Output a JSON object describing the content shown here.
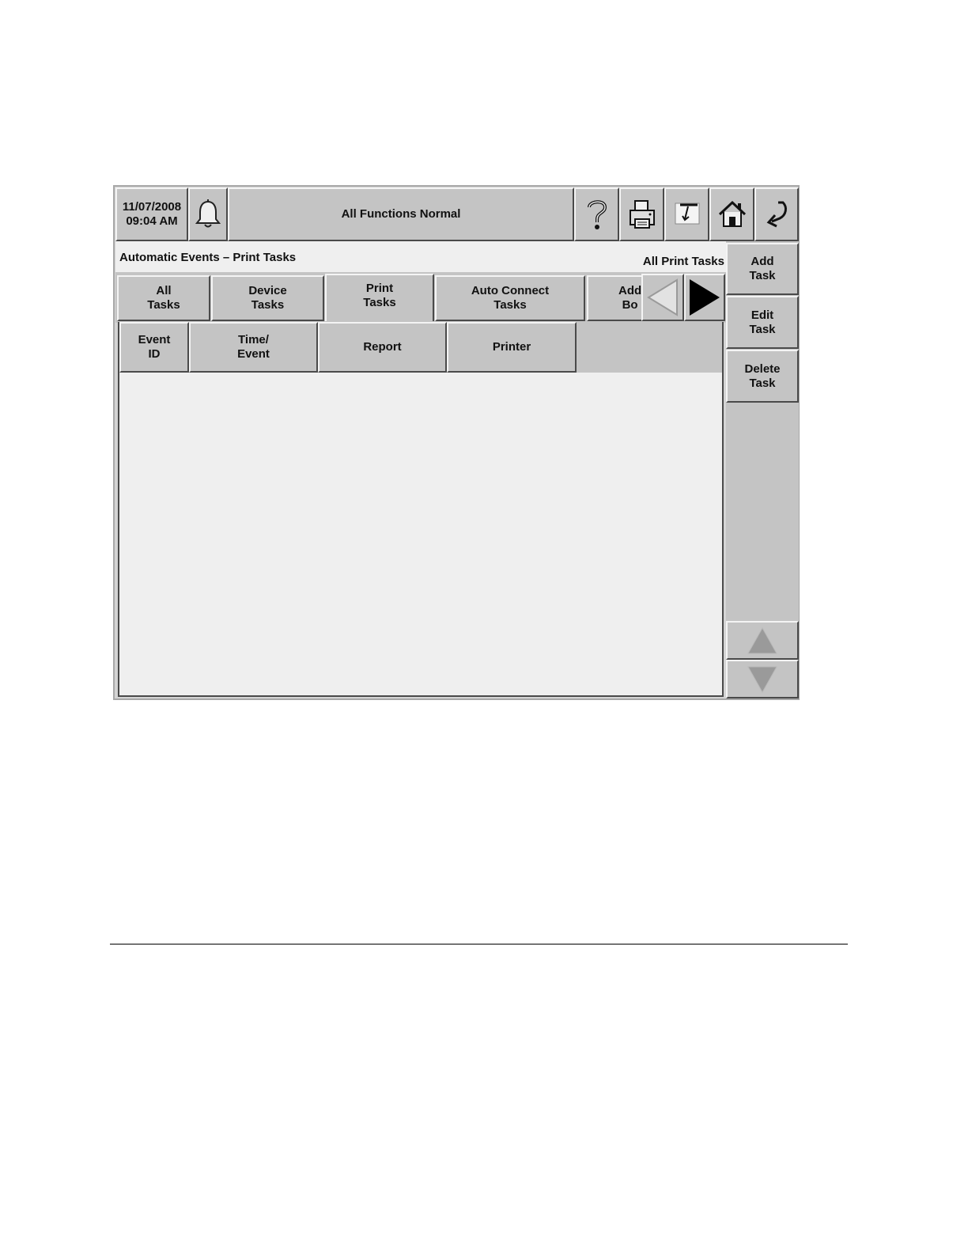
{
  "status_bar": {
    "date": "11/07/2008",
    "time": "09:04 AM",
    "status_message": "All Functions Normal",
    "icons": [
      "bell-icon",
      "help-icon",
      "print-icon",
      "calibrate-icon",
      "home-icon",
      "back-icon"
    ]
  },
  "header": {
    "title": "Automatic Events – Print Tasks",
    "filter_label": "All Print Tasks"
  },
  "tabs": [
    {
      "label": "All\nTasks",
      "selected": false
    },
    {
      "label": "Device\nTasks",
      "selected": false
    },
    {
      "label": "Print\nTasks",
      "selected": true
    },
    {
      "label": "Auto Connect\nTasks",
      "selected": false
    },
    {
      "label": "Add\nBo",
      "selected": false
    }
  ],
  "table": {
    "columns": [
      "Event\nID",
      "Time/\nEvent",
      "Report",
      "Printer"
    ],
    "rows": []
  },
  "side_buttons": {
    "add_task": "Add\nTask",
    "edit_task": "Edit\nTask",
    "delete_task": "Delete\nTask"
  },
  "colors": {
    "panel": "#c4c4c4",
    "content_background": "#efefef"
  }
}
